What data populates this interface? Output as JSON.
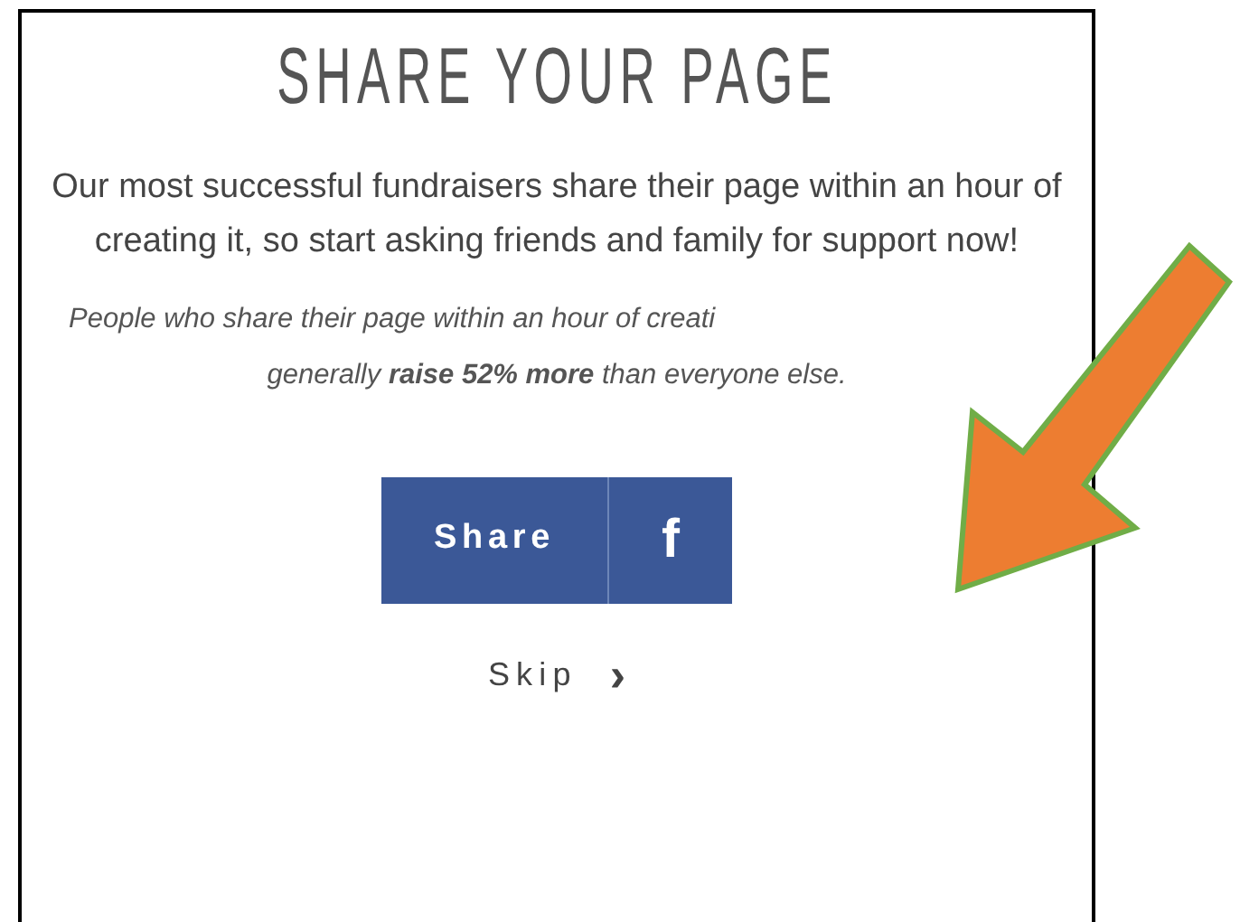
{
  "card": {
    "title": "SHARE YOUR PAGE",
    "intro": "Our most successful fundraisers share their page within an hour of creating it, so start asking friends and family for support now!",
    "stat_line_1": "People who share their page within an hour of creati",
    "stat_line_2": "generally **raise 52% more** than everyone else.",
    "share_button": {
      "label": "Share",
      "icon_text": "f"
    },
    "skip_link": {
      "label": "Skip",
      "icon_text": "›"
    }
  }
}
